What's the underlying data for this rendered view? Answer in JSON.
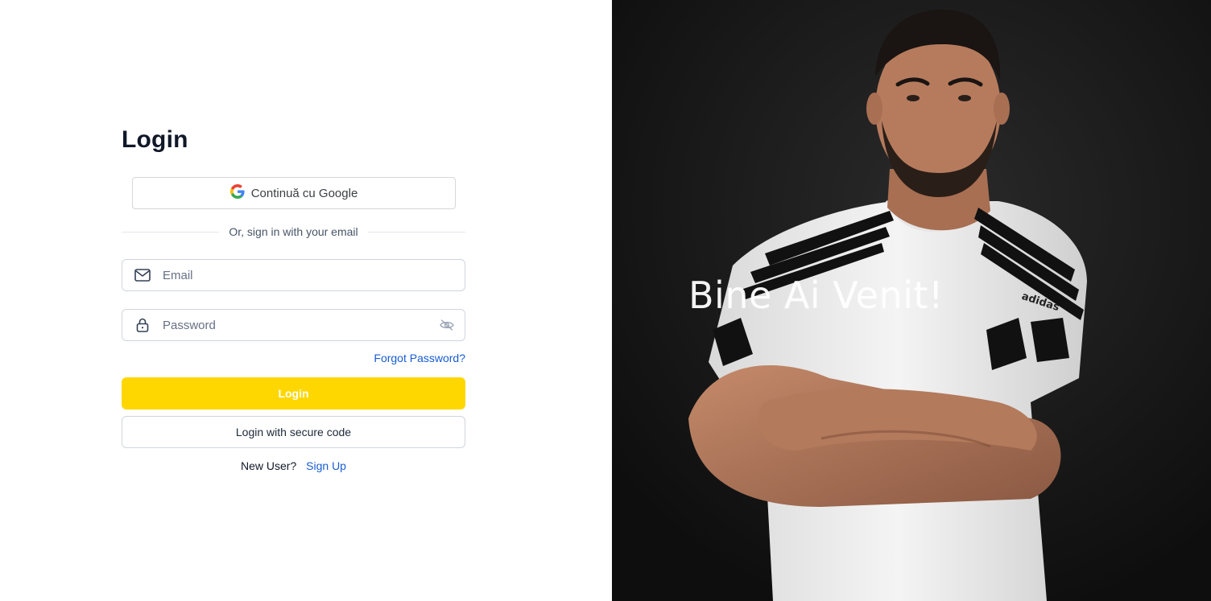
{
  "login": {
    "title": "Login",
    "google_button_label": "Continuă cu Google",
    "divider_text": "Or, sign in with your email",
    "email_placeholder": "Email",
    "password_placeholder": "Password",
    "forgot_password": "Forgot Password?",
    "login_button": "Login",
    "secure_code_button": "Login with secure code",
    "new_user_text": "New User?",
    "sign_up_link": "Sign Up"
  },
  "hero": {
    "welcome_text": "Bine Ai Venit!",
    "shirt_logo": "adidas"
  },
  "colors": {
    "accent": "#FFD700",
    "link": "#175CD3",
    "heading": "#101828",
    "hero_background": "#141414"
  },
  "icons": {
    "google_button": "google-logo-icon",
    "email_field": "mail-icon",
    "password_field": "lock-icon",
    "password_toggle": "eye-off-icon"
  }
}
